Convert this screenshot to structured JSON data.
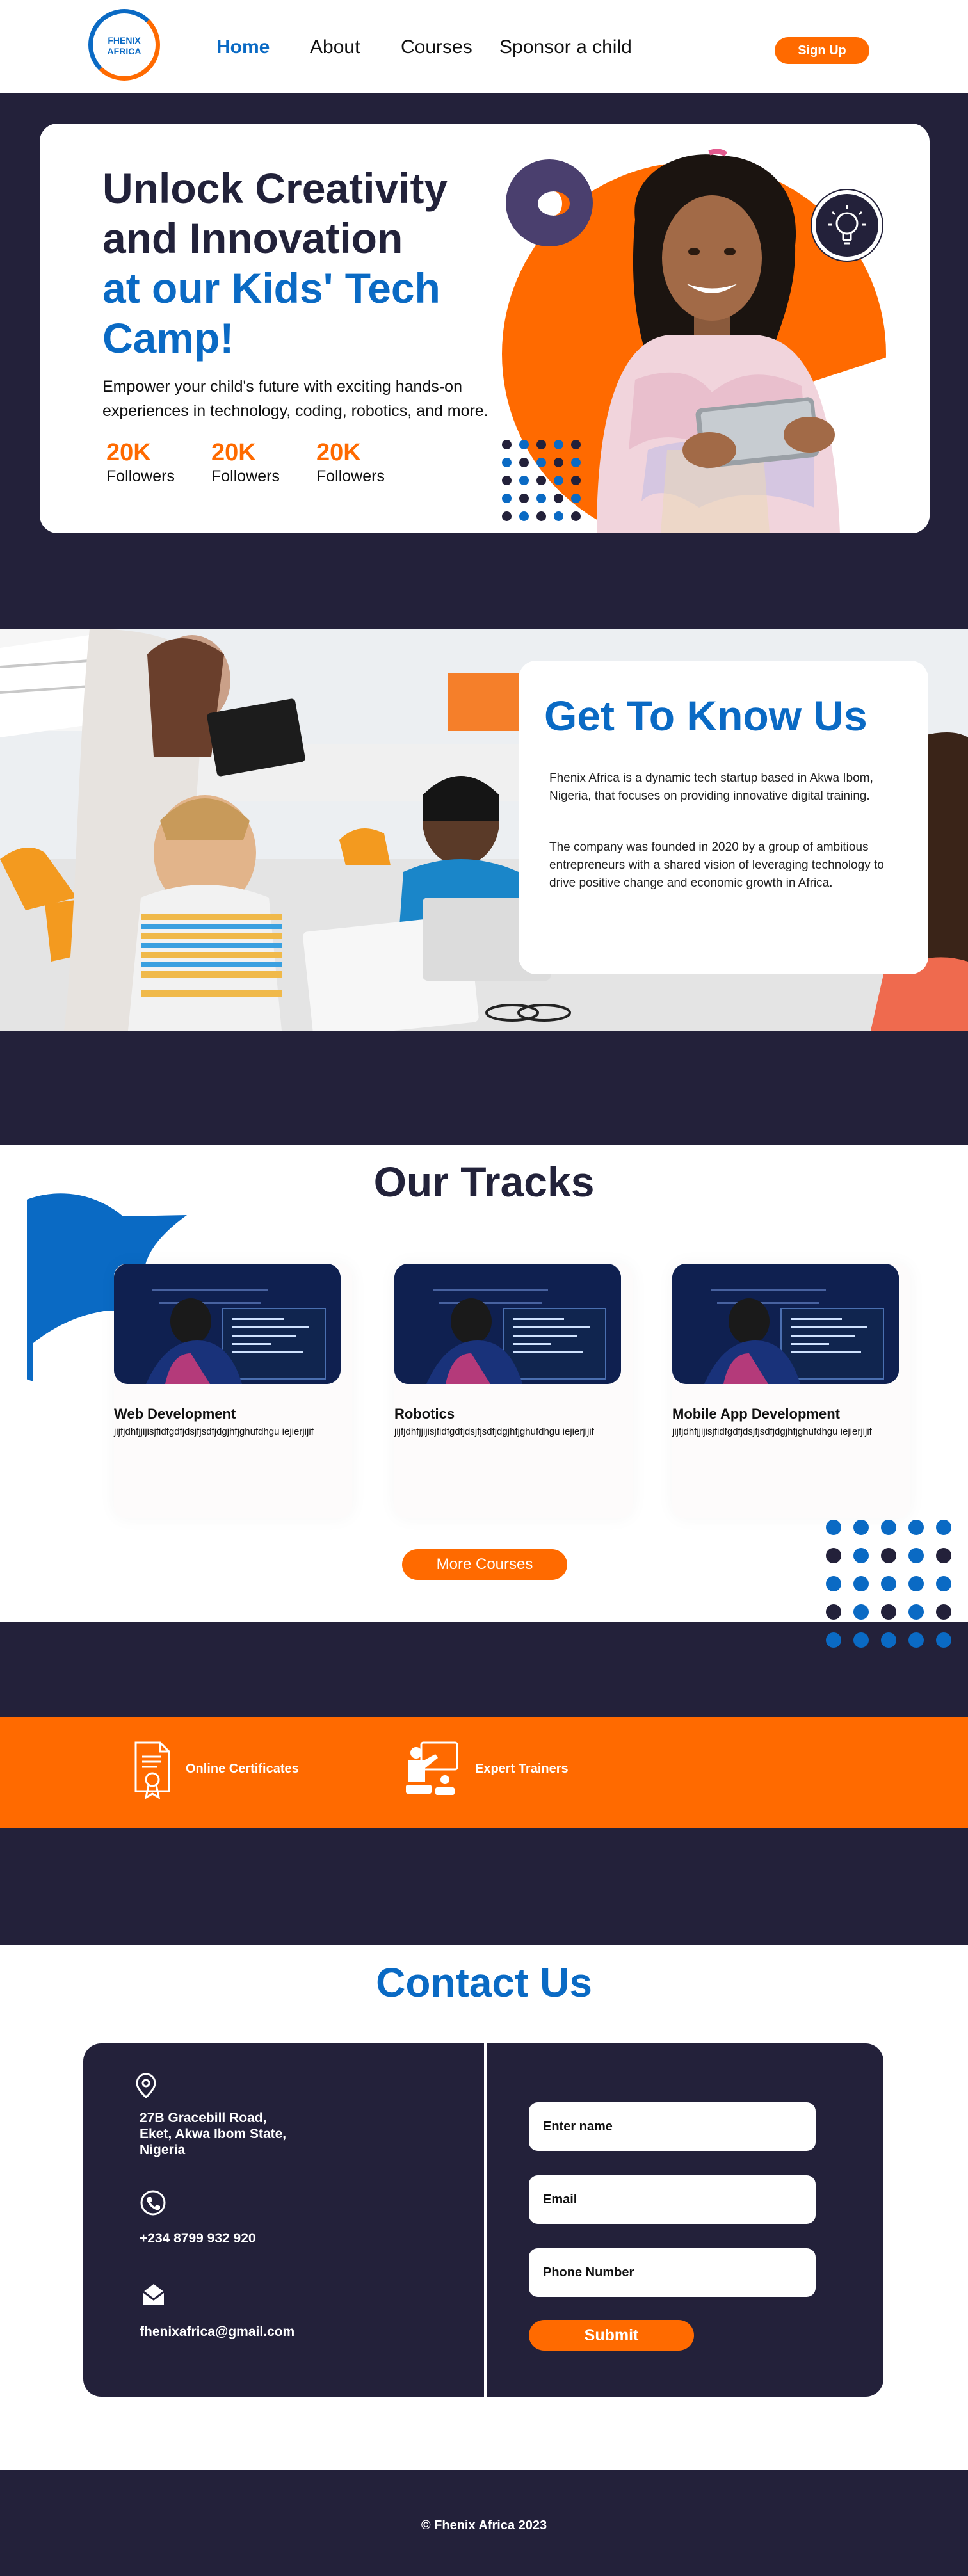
{
  "brand": {
    "logo_text": "FHENIX AFRICA",
    "orange": "#ff6a00",
    "blue": "#0a6ac4",
    "navy": "#23213a"
  },
  "nav": {
    "items": [
      {
        "label": "Home",
        "active": true
      },
      {
        "label": "About",
        "active": false
      },
      {
        "label": "Courses",
        "active": false
      },
      {
        "label": "Sponsor a child",
        "active": false
      }
    ],
    "signup_label": "Sign Up"
  },
  "hero": {
    "title_line1": "Unlock Creativity",
    "title_line2": "and Innovation",
    "title_line3": "at our Kids' Tech",
    "title_line4": "Camp!",
    "subtitle": "Empower your child's future with exciting hands-on experiences in technology, coding, robotics, and more.",
    "stats": [
      {
        "value": "20K",
        "label": "Followers"
      },
      {
        "value": "20K",
        "label": "Followers"
      },
      {
        "value": "20K",
        "label": "Followers"
      }
    ],
    "decor_icon": "lightbulb-icon"
  },
  "about": {
    "title": "Get To Know Us",
    "paragraph1": "Fhenix Africa is a dynamic tech startup based in Akwa Ibom, Nigeria, that focuses on providing innovative digital training.",
    "paragraph2": "The company was founded in 2020 by a group of ambitious entrepreneurs with a shared vision of leveraging technology to drive positive change and economic growth in Africa."
  },
  "tracks": {
    "title": "Our Tracks",
    "items": [
      {
        "name": "Web Development",
        "desc": "jijfjdhfjjijisjfidfgdfjdsjfjsdfjdgjhfjghufdhgu iejierjijif"
      },
      {
        "name": "Robotics",
        "desc": "jijfjdhfjjijisjfidfgdfjdsjfjsdfjdgjhfjghufdhgu iejierjijif"
      },
      {
        "name": "Mobile App Development",
        "desc": "jijfjdhfjjijisjfidfgdfjdsjfjsdfjdgjhfjghufdhgu iejierjijif"
      }
    ],
    "more_label": "More Courses"
  },
  "features": {
    "items": [
      {
        "label": "Online Certificates",
        "icon": "certificate-icon"
      },
      {
        "label": "Expert Trainers",
        "icon": "trainer-icon"
      }
    ]
  },
  "contact": {
    "title": "Contact Us",
    "address_line1": "27B Gracebill Road,",
    "address_line2": "Eket, Akwa Ibom State,",
    "address_line3": "Nigeria",
    "phone": "+234 8799 932 920",
    "email": "fhenixafrica@gmail.com",
    "form": {
      "name_placeholder": "Enter name",
      "email_placeholder": "Email",
      "phone_placeholder": "Phone Number",
      "submit_label": "Submit"
    }
  },
  "footer": {
    "copyright": "© Fhenix Africa 2023"
  }
}
